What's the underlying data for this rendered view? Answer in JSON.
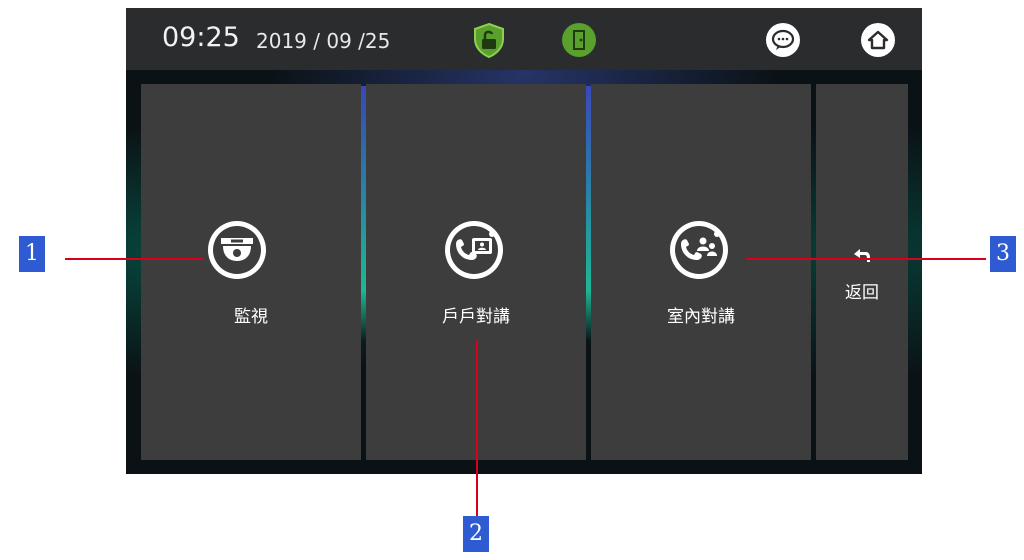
{
  "status_bar": {
    "time": "09:25",
    "date": "2019 / 09 /25",
    "icons": [
      "unlock-shield-icon",
      "door-icon",
      "message-icon",
      "home-icon"
    ]
  },
  "tiles": [
    {
      "label": "監視",
      "icon": "camera-dome-icon"
    },
    {
      "label": "戶戶對講",
      "icon": "unit-intercom-icon"
    },
    {
      "label": "室內對講",
      "icon": "indoor-intercom-icon"
    }
  ],
  "back": {
    "label": "返回",
    "icon": "back-arrow-icon"
  },
  "callouts": [
    "1",
    "2",
    "3"
  ],
  "colors": {
    "accent_green": "#5aa02c",
    "callout_blue": "#2f5bd2",
    "callout_line": "#d9001b",
    "tile_bg": "#3d3d3e",
    "topbar_bg": "#2a2c2e"
  }
}
